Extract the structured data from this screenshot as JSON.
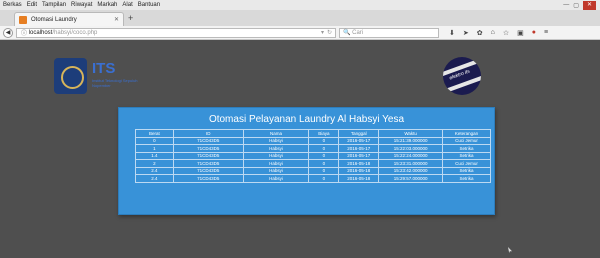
{
  "browser": {
    "menu": [
      "Berkas",
      "Edit",
      "Tampilan",
      "Riwayat",
      "Markah",
      "Alat",
      "Bantuan"
    ],
    "tab_title": "Otomasi Laundry",
    "url_host": "localhost",
    "url_path": "/habsyi/coco.php",
    "search_placeholder": "Cari"
  },
  "header": {
    "logo_text": "ITS",
    "logo_sub": "Institut Teknologi Sepuluh Nopember",
    "globe_label": "elektro its"
  },
  "card": {
    "title": "Otomasi Pelayanan Laundry Al Habsyi Yesa",
    "columns": [
      "Berat",
      "ID",
      "Nama",
      "Biaya",
      "Tanggal",
      "Waktu",
      "Keterangan"
    ],
    "rows": [
      [
        "0",
        "71CD43D5",
        "Habsyi",
        "0",
        "2016-05-17",
        "15:21:39.000000",
        "Cuci Jemur"
      ],
      [
        "1",
        "71CD43D5",
        "Habsyi",
        "0",
        "2016-05-17",
        "15:22:03.000000",
        "Setrika"
      ],
      [
        "1.4",
        "71CD43D5",
        "Habsyi",
        "0",
        "2016-05-17",
        "15:22:24.000000",
        "Setrika"
      ],
      [
        "2",
        "71CD43D5",
        "Habsyi",
        "0",
        "2016-05-18",
        "15:23:31.000000",
        "Cuci Jemur"
      ],
      [
        "2.4",
        "71CD43D5",
        "Habsyi",
        "0",
        "2016-05-18",
        "15:23:42.000000",
        "Setrika"
      ],
      [
        "2.4",
        "71CD43D5",
        "Habsyi",
        "0",
        "2016-05-18",
        "15:29:57.000000",
        "Setrika"
      ]
    ]
  }
}
